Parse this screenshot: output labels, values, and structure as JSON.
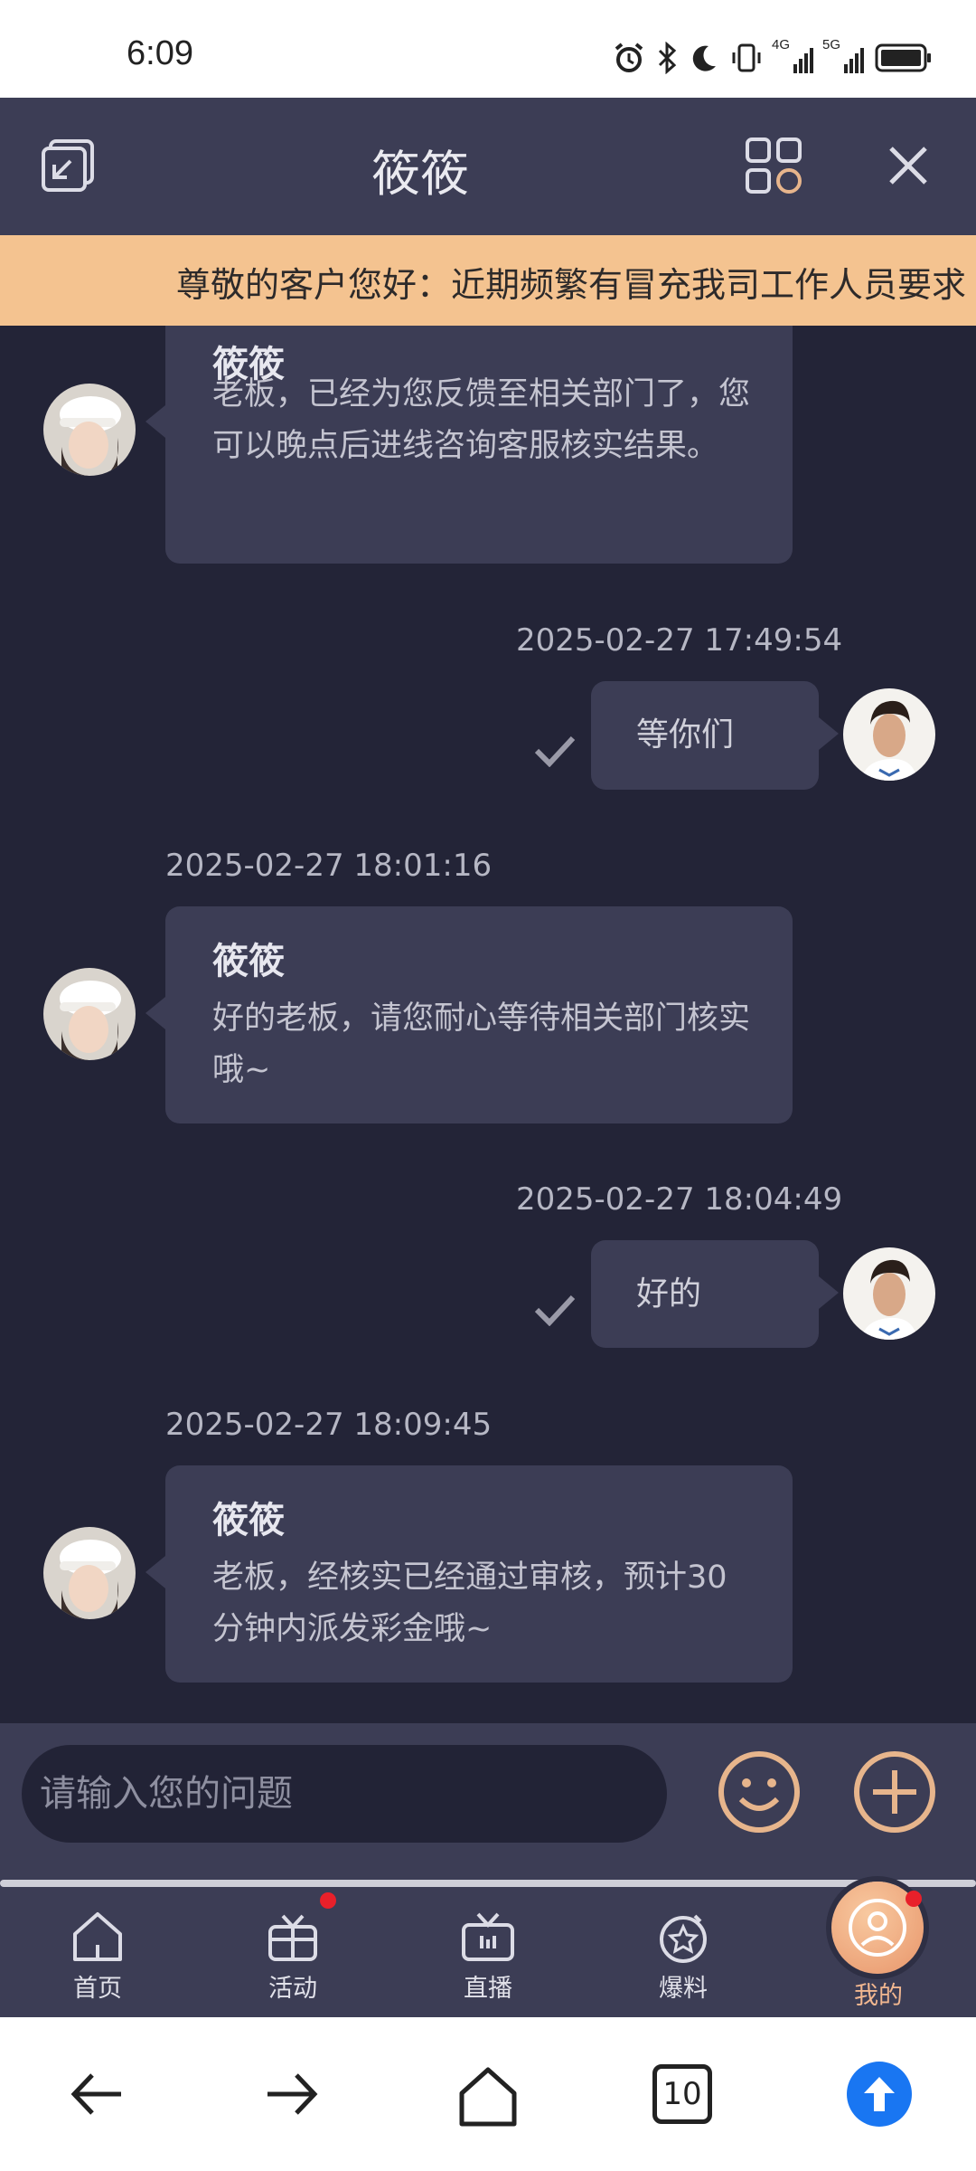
{
  "status_bar": {
    "time": "6:09",
    "net1": "4G",
    "net2": "5G",
    "icons": [
      "alarm-icon",
      "bluetooth-icon",
      "moon-icon",
      "vibrate-icon",
      "signal-4g-icon",
      "signal-5g-icon",
      "battery-icon"
    ]
  },
  "header": {
    "title": "筱筱",
    "left_icon": "minimize-window-icon",
    "grid_icon": "apps-grid-icon",
    "close_icon": "close-icon"
  },
  "notice": {
    "text": "尊敬的客户您好：近期频繁有冒充我司工作人员要求"
  },
  "messages": {
    "m1": {
      "sender": "筱筱",
      "text": "老板，已经为您反馈至相关部门了，您可以晚点后进线咨询客服核实结果。"
    },
    "m2": {
      "timestamp": "2025-02-27 17:49:54",
      "text": "等你们"
    },
    "m3": {
      "timestamp": "2025-02-27 18:01:16",
      "sender": "筱筱",
      "text": "好的老板，请您耐心等待相关部门核实哦~"
    },
    "m4": {
      "timestamp": "2025-02-27 18:04:49",
      "text": "好的"
    },
    "m5": {
      "timestamp": "2025-02-27 18:09:45",
      "sender": "筱筱",
      "text": "老板，经核实已经通过审核，预计30分钟内派发彩金哦~"
    }
  },
  "input": {
    "placeholder": "请输入您的问题",
    "emoji_icon": "emoji-icon",
    "plus_icon": "plus-icon"
  },
  "tabs": [
    {
      "label": "首页",
      "icon": "home-icon"
    },
    {
      "label": "活动",
      "icon": "gift-icon"
    },
    {
      "label": "直播",
      "icon": "tv-icon"
    },
    {
      "label": "爆料",
      "icon": "star-badge-icon"
    },
    {
      "label": "我的",
      "icon": "profile-icon"
    }
  ],
  "browser_nav": {
    "tab_count": "10",
    "icons": [
      "back-arrow-icon",
      "forward-arrow-icon",
      "home-icon",
      "tabs-icon",
      "upload-icon"
    ]
  },
  "colors": {
    "header_bg": "#3c3d55",
    "chat_bg": "#232437",
    "notice_bg": "#f4c390",
    "accent_gold": "#e7b58c",
    "active_tab": "#f2b790",
    "upload_blue": "#1976f2"
  }
}
